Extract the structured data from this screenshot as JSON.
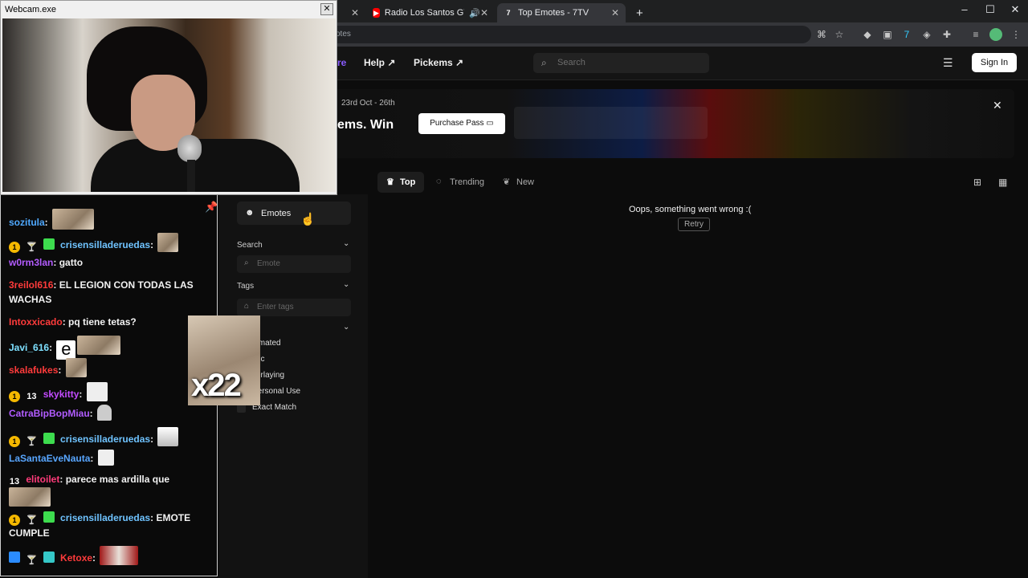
{
  "browser": {
    "tabs": [
      {
        "label": "",
        "active": false
      },
      {
        "label": "Radio Los Santos GTA San",
        "active": false
      },
      {
        "label": "Top Emotes - 7TV",
        "active": true
      }
    ],
    "new_tab": "+",
    "url_partial": "otes",
    "window_controls": {
      "minimize": "–",
      "maximize": "☐",
      "close": "✕"
    }
  },
  "site": {
    "nav": {
      "partial_link": "re",
      "help": "Help",
      "pickems": "Pickems",
      "search_placeholder": "Search",
      "sign_in": "Sign In"
    },
    "banner": {
      "date": "23rd Oct - 26th",
      "title": "ems. Win",
      "purchase": "Purchase Pass"
    },
    "sidebar": {
      "emotes": "Emotes",
      "search_label": "Search",
      "search_placeholder": "Emote",
      "tags_label": "Tags",
      "tags_placeholder": "Enter tags",
      "filters": [
        "nimated",
        "atic",
        "verlaying",
        "Personal Use",
        "Exact Match"
      ]
    },
    "tabs": {
      "top": "Top",
      "trending": "Trending",
      "new": "New"
    },
    "error": "Oops, something went wrong :(",
    "retry": "Retry"
  },
  "chat": {
    "messages": [
      {
        "user": "sozitula",
        "color": "#4fa9ff",
        "text": ""
      },
      {
        "user": "crisensilladeruedas",
        "color": "#6fc3ff",
        "text": ""
      },
      {
        "user": "w0rm3lan",
        "color": "#b35cff",
        "text": "gatto"
      },
      {
        "user": "3reilol616",
        "color": "#ff3b3b",
        "text": "EL LEGION CON TODAS LAS WACHAS"
      },
      {
        "user": "Intoxxicado",
        "color": "#ff3b3b",
        "text": "pq tiene tetas?"
      },
      {
        "user": "Javi_616",
        "color": "#7ee0ff",
        "text": "e"
      },
      {
        "user": "skalafukes",
        "color": "#ff3b3b",
        "text": ""
      },
      {
        "user": "skykitty",
        "color": "#c34bff",
        "text": ""
      },
      {
        "user": "CatraBipBopMiau",
        "color": "#b15cff",
        "text": ""
      },
      {
        "user": "crisensilladeruedas",
        "color": "#6fc3ff",
        "text": ""
      },
      {
        "user": "LaSantaEveNauta",
        "color": "#58a6ff",
        "text": ""
      },
      {
        "user": "elitoilet",
        "color": "#ff3b7a",
        "text": "parece mas ardilla que"
      },
      {
        "user": "crisensilladeruedas",
        "color": "#6fc3ff",
        "text": "EMOTE CUMPLE"
      },
      {
        "user": "Ketoxe",
        "color": "#ff3b3b",
        "text": ""
      }
    ],
    "emote_count": "x22"
  },
  "webcam": {
    "title": "Webcam.exe",
    "close": "✕"
  }
}
